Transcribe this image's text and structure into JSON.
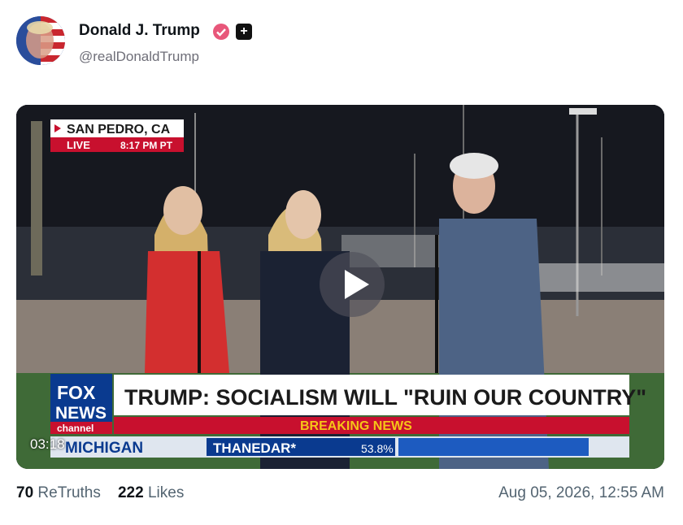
{
  "post": {
    "display_name": "Donald J. Trump",
    "handle": "@realDonaldTrump",
    "verified_color": "#e8577a",
    "badge_icons": [
      "verified-badge-icon",
      "plus-badge-icon"
    ],
    "video": {
      "duration": "03:18",
      "location": "SAN PEDRO, CA",
      "live_label": "LIVE",
      "live_time": "8:17 PM PT",
      "headline": "TRUMP: SOCIALISM WILL \"RUIN OUR COUNTRY\"",
      "breaking": "BREAKING NEWS",
      "network_line1": "FOX",
      "network_line2": "NEWS",
      "network_line3": "channel",
      "ticker_state": "MICHIGAN",
      "ticker_candidate": "THANEDAR*",
      "ticker_percent": "53.8%"
    },
    "stats": {
      "retruths_count": "70",
      "retruths_label": "ReTruths",
      "likes_count": "222",
      "likes_label": "Likes"
    },
    "timestamp": "Aug 05, 2026, 12:55 AM"
  }
}
